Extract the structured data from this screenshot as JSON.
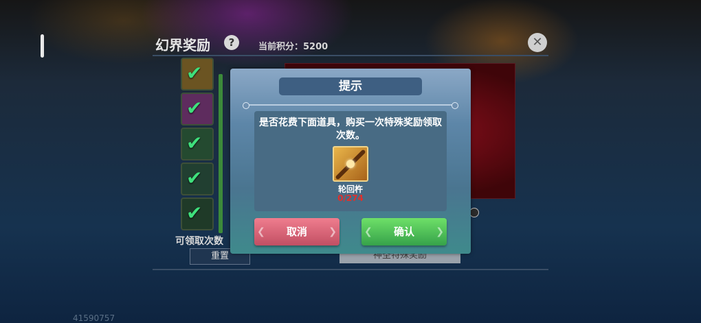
{
  "panel": {
    "title": "幻界奖励",
    "help_icon": "?",
    "points_label": "当前积分：5200",
    "close_icon": "✕",
    "claim_label": "可领取次数",
    "reset_button": "重置",
    "special_reward_button": "神圣特殊奖励"
  },
  "slots": [
    {
      "icon": "check-icon",
      "checked": true,
      "color": "#8a6a2a"
    },
    {
      "icon": "check-icon",
      "checked": true,
      "color": "#7a3a7a"
    },
    {
      "icon": "check-icon",
      "checked": true,
      "color": "#2a5a3a"
    },
    {
      "icon": "check-icon",
      "checked": true,
      "color": "#2a4a3a"
    },
    {
      "icon": "check-icon",
      "checked": true,
      "color": "#2a4a30"
    }
  ],
  "dialog": {
    "title": "提示",
    "message": "是否花费下面道具，购买一次特殊奖励领取次数。",
    "item_name": "轮回杵",
    "item_count": "0/274",
    "cancel_button": "取消",
    "confirm_button": "确认"
  },
  "user_id": "41590757",
  "colors": {
    "cancel": "#d9607a",
    "confirm": "#4cc158",
    "count_red": "#e0302c"
  }
}
